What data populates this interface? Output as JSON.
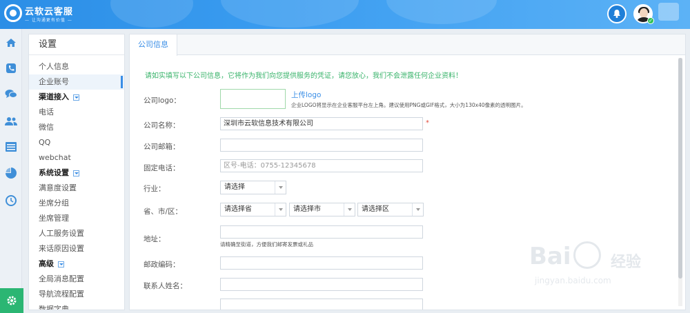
{
  "header": {
    "brand": "云软云客服",
    "slogan": "— 让沟通更有价值 —"
  },
  "rail": {
    "icons": [
      "home-icon",
      "phone-icon",
      "chat-icon",
      "users-icon",
      "list-icon",
      "pie-chart-icon",
      "history-icon"
    ],
    "settings_icon": "gear-icon"
  },
  "menu": {
    "title": "设置",
    "items": [
      {
        "label": "个人信息",
        "type": "item"
      },
      {
        "label": "企业账号",
        "type": "item",
        "active": true
      },
      {
        "label": "渠道接入",
        "type": "group"
      },
      {
        "label": "电话",
        "type": "item"
      },
      {
        "label": "微信",
        "type": "item"
      },
      {
        "label": "QQ",
        "type": "item"
      },
      {
        "label": "webchat",
        "type": "item"
      },
      {
        "label": "系统设置",
        "type": "group"
      },
      {
        "label": "满意度设置",
        "type": "item"
      },
      {
        "label": "坐席分组",
        "type": "item"
      },
      {
        "label": "坐席管理",
        "type": "item"
      },
      {
        "label": "人工服务设置",
        "type": "item"
      },
      {
        "label": "来话原因设置",
        "type": "item"
      },
      {
        "label": "高级",
        "type": "group"
      },
      {
        "label": "全局消息配置",
        "type": "item"
      },
      {
        "label": "导航流程配置",
        "type": "item"
      },
      {
        "label": "数据字典",
        "type": "item"
      }
    ]
  },
  "tabs": [
    "公司信息"
  ],
  "form": {
    "notice": "请如实填写以下公司信息，它将作为我们向您提供服务的凭证，请您放心，我们不会泄露任何企业资料！",
    "logo_label": "公司logo：",
    "upload_label": "上传logo",
    "upload_hint": "企业LOGO将显示在企业客服平台左上角。建议使用PNG或GIF格式，大小为130x40像素的透明图片。",
    "company_name_label": "公司名称：",
    "company_name_value": "深圳市云软信息技术有限公司",
    "required_mark": "*",
    "email_label": "公司邮箱：",
    "email_value": "",
    "phone_label": "固定电话：",
    "phone_placeholder": "区号-电话：0755-12345678",
    "industry_label": "行业：",
    "industry_value": "请选择",
    "region_label": "省、市/区：",
    "province_value": "请选择省",
    "city_value": "请选择市",
    "district_value": "请选择区",
    "address_label": "地址：",
    "address_value": "",
    "address_hint": "请精确至街道，方便我们邮寄发票或礼品",
    "zipcode_label": "邮政编码：",
    "zipcode_value": "",
    "contact_label": "联系人姓名：",
    "contact_value": ""
  },
  "watermark": {
    "brand": "Bai",
    "jingyan": "经验",
    "url": "jingyan.baidu.com"
  }
}
